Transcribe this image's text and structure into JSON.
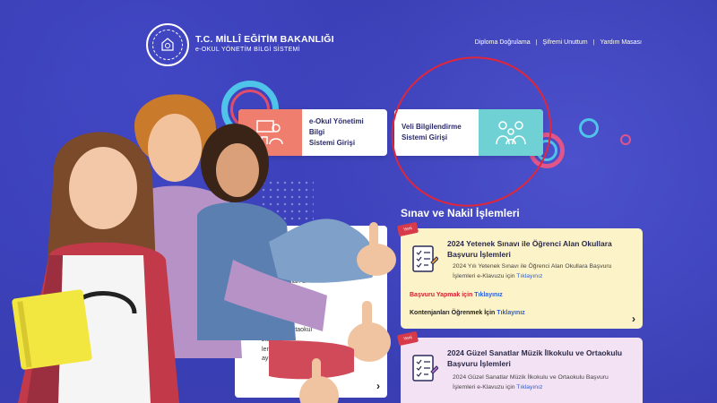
{
  "header": {
    "brand_title": "T.C. MİLLÎ EĞİTİM BAKANLIĞI",
    "brand_subtitle": "e-OKUL YÖNETİM BİLGİ SİSTEMİ",
    "nav": [
      {
        "label": "Diploma Doğrulama"
      },
      {
        "label": "Şifremi Unuttum"
      },
      {
        "label": "Yardım Masası"
      }
    ]
  },
  "login_cards": {
    "eokul": {
      "label_line1": "e-Okul Yönetimi Bilgi",
      "label_line2": "Sistemi Girişi",
      "icon": "teacher-icon"
    },
    "veli": {
      "label_line1": "Veli Bilgilendirme",
      "label_line2": "Sistemi Girişi",
      "icon": "family-icon"
    }
  },
  "section": {
    "title": "Sınav ve Nakil İşlemleri"
  },
  "info_card": {
    "lines": [
      "okul",
      "nde olan öğrenciler ve",
      "aatli ile alınan 8/",
      "caktır.",
      "ri maddesine",
      "recek ilan kura",
      "n ikinci i  ilk iş günü e-",
      "ile belirle   Ortaokul",
      "zle",
      "lerinize göre",
      "ayıt yaptırmanız gereken"
    ]
  },
  "announcements": [
    {
      "badge": "Yeni",
      "title": "2024 Yetenek Sınavı ile Öğrenci Alan Okullara Başvuru İşlemleri",
      "desc_text": "2024 Yılı Yetenek Sınavı ile Öğrenci Alan Okullara Başvuru İşlemleri e-Klavuzu için",
      "desc_link": "Tıklayınız",
      "row1_label": "Başvuru Yapmak için",
      "row1_link": "Tıklayınız",
      "row2_label": "Kontenjanları Öğrenmek İçin",
      "row2_link": "Tıklayınız"
    },
    {
      "badge": "Yeni",
      "title": "2024 Güzel Sanatlar Müzik İlkokulu ve Ortaokulu Başvuru İşlemleri",
      "desc_text": "2024 Güzel Sanatlar Müzik İlkokulu ve Ortaokulu Başvuru İşlemleri e-Klavuzu için",
      "desc_link": "Tıklayınız"
    }
  ],
  "colors": {
    "background": "#3a3fb6",
    "eokul_accent": "#f07e6e",
    "veli_accent": "#6fd1d3",
    "highlight_oval": "#e0263a",
    "card_yellow": "#fdf3c8",
    "card_pink": "#f3e2f3"
  }
}
